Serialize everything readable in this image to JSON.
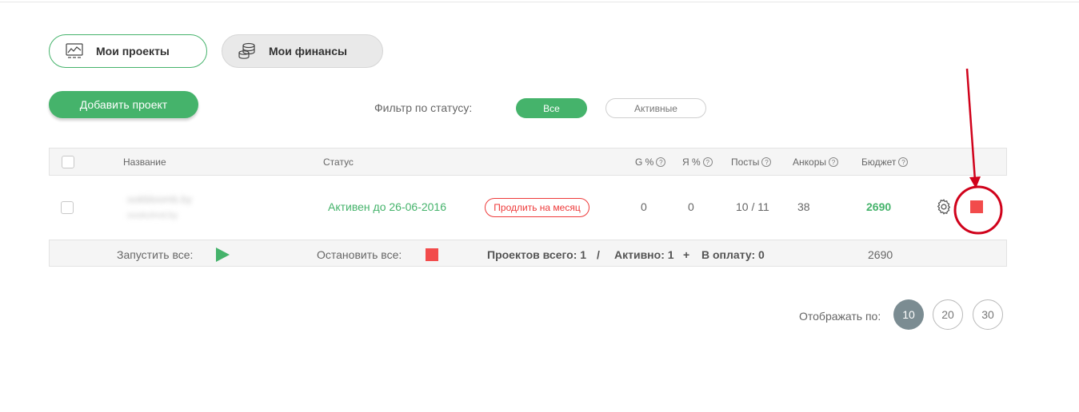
{
  "tabs": [
    {
      "label": "Мои проекты",
      "icon": "projects-icon"
    },
    {
      "label": "Мои финансы",
      "icon": "coins-icon"
    }
  ],
  "add_project_label": "Добавить проект",
  "filter": {
    "label": "Фильтр по статусу:",
    "options": [
      "Все",
      "Активные"
    ],
    "selected": "Все"
  },
  "table": {
    "headers": {
      "name": "Название",
      "status": "Статус",
      "g": "G %",
      "ya": "Я %",
      "posts": "Посты",
      "anchors": "Анкоры",
      "budget": "Бюджет"
    },
    "rows": [
      {
        "name": "ookbloomb.by",
        "subtitle": "oookuhnd.by",
        "status": "Активен до 26-06-2016",
        "extend_label": "Продлить на месяц",
        "g": "0",
        "ya": "0",
        "posts": "10 / 11",
        "anchors": "38",
        "budget": "2690"
      }
    ]
  },
  "footer": {
    "start_all": "Запустить все:",
    "stop_all": "Остановить все:",
    "projects_total": "Проектов всего: 1",
    "separator": "/",
    "active": "Активно: 1",
    "plus": "+",
    "to_pay": "В оплату: 0",
    "budget_total": "2690"
  },
  "pager": {
    "label": "Отображать по:",
    "options": [
      "10",
      "20",
      "30"
    ],
    "selected": "10"
  },
  "colors": {
    "accent_green": "#45b36b",
    "stop_red": "#f24b4b",
    "annotation_red": "#d0021b"
  }
}
